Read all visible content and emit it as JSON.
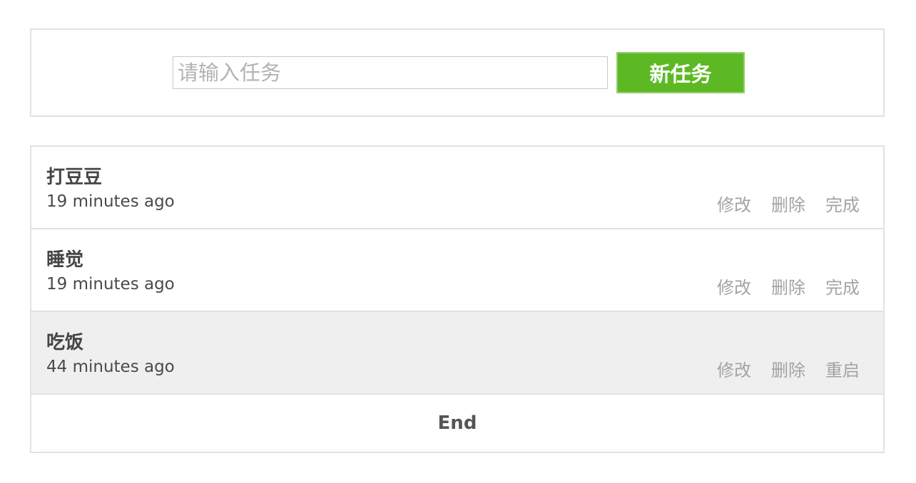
{
  "new_task": {
    "placeholder": "请输入任务",
    "value": "",
    "button_label": "新任务"
  },
  "tasks": [
    {
      "title": "打豆豆",
      "time": "19 minutes ago",
      "status": "active",
      "actions": [
        "修改",
        "删除",
        "完成"
      ]
    },
    {
      "title": "睡觉",
      "time": "19 minutes ago",
      "status": "active",
      "actions": [
        "修改",
        "删除",
        "完成"
      ]
    },
    {
      "title": "吃饭",
      "time": "44 minutes ago",
      "status": "done",
      "actions": [
        "修改",
        "删除",
        "重启"
      ]
    }
  ],
  "list_end_label": "End",
  "colors": {
    "button_green": "#5db923",
    "done_row_background": "#efefef",
    "border": "#e2e2e2",
    "action_text": "#a3a3a3"
  }
}
